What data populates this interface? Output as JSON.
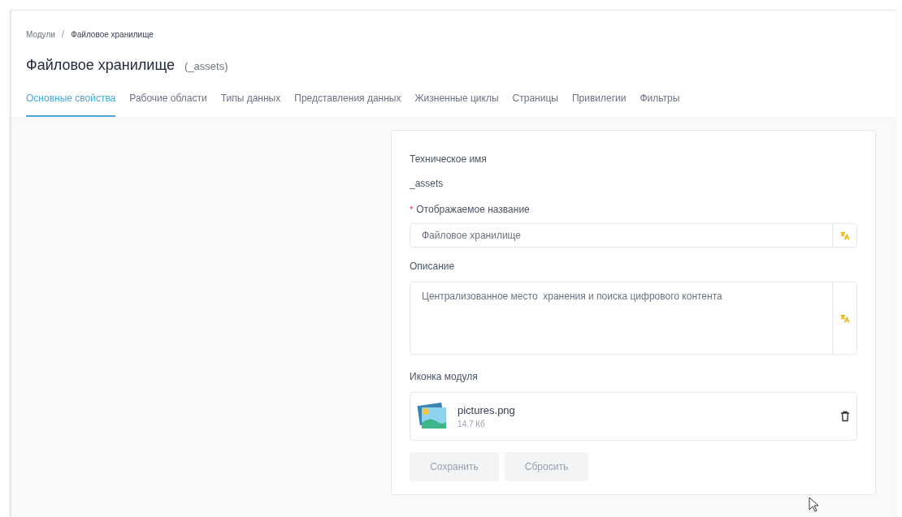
{
  "breadcrumbs": [
    {
      "label": "Модули"
    },
    {
      "label": "Файловое хранилище"
    }
  ],
  "breadcrumb_separator": "/",
  "title": "Файловое хранилище",
  "title_suffix": "(_assets)",
  "tabs": [
    {
      "label": "Основные свойства",
      "selected": true
    },
    {
      "label": "Рабочие области",
      "selected": false
    },
    {
      "label": "Типы данных",
      "selected": false
    },
    {
      "label": "Представления данных",
      "selected": false
    },
    {
      "label": "Жизненные циклы",
      "selected": false
    },
    {
      "label": "Страницы",
      "selected": false
    },
    {
      "label": "Привилегии",
      "selected": false
    },
    {
      "label": "Фильтры",
      "selected": false
    }
  ],
  "form": {
    "technical_name": {
      "label": "Техническое имя",
      "value": "_assets"
    },
    "display_name": {
      "label": "Отображаемое название",
      "required": true,
      "required_mark": "*",
      "value": "Файловое хранилище"
    },
    "description": {
      "label": "Описание",
      "value": "Централизованное место  хранения и поиска цифрового контента"
    },
    "module_icon": {
      "label": "Иконка модуля",
      "file_name": "pictures.png",
      "file_size": "14.7 Кб"
    },
    "buttons": [
      {
        "label": "Сохранить",
        "disabled": true
      },
      {
        "label": "Сбросить",
        "disabled": true
      }
    ]
  }
}
